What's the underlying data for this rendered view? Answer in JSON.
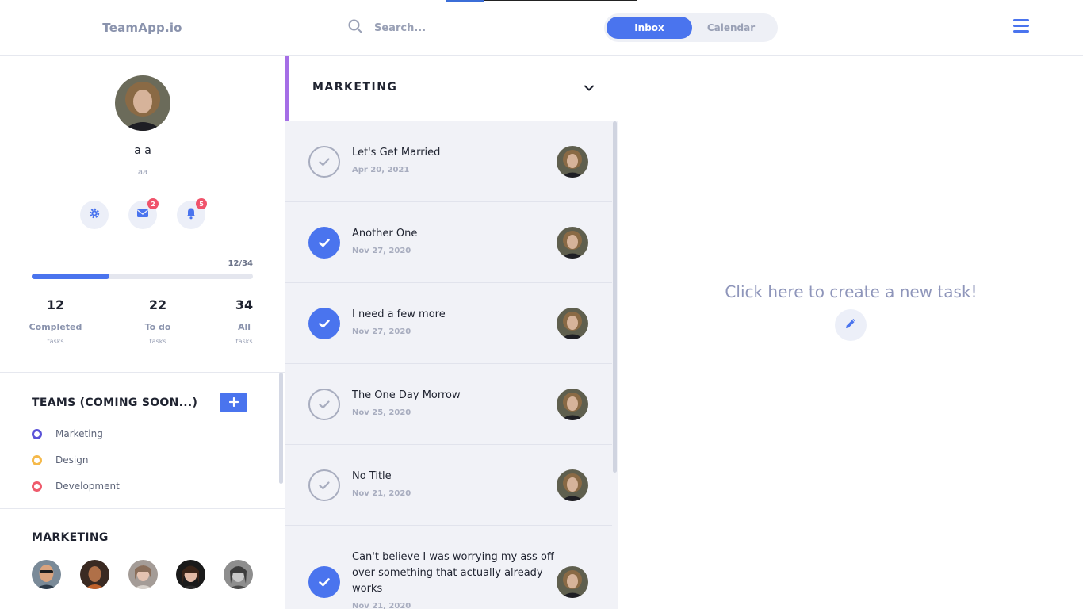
{
  "brand": {
    "name": "TeamApp.io"
  },
  "search": {
    "placeholder": "Search...",
    "icon": "search-icon"
  },
  "view_toggle": {
    "inbox_label": "Inbox",
    "calendar_label": "Calendar",
    "active": "Inbox"
  },
  "menu": {
    "icon": "hamburger-menu-icon"
  },
  "colors": {
    "accent": "#4a74ee",
    "badge": "#f0536b",
    "section_accent": "#a56ee6",
    "team_marketing": "#5b53d8",
    "team_design": "#f5b94a",
    "team_development": "#ef5b6c"
  },
  "profile": {
    "name": "a a",
    "handle": "aa",
    "buttons": [
      {
        "icon": "gear-icon",
        "badge": null
      },
      {
        "icon": "mail-icon",
        "badge": "2"
      },
      {
        "icon": "bell-icon",
        "badge": "5"
      }
    ]
  },
  "progress": {
    "count_text": "12/34",
    "completed": 12,
    "total": 34
  },
  "stats": [
    {
      "value": "12",
      "label": "Completed",
      "sub": "tasks"
    },
    {
      "value": "22",
      "label": "To do",
      "sub": "tasks"
    },
    {
      "value": "34",
      "label": "All",
      "sub": "tasks"
    }
  ],
  "teams": {
    "title": "TEAMS (COMING SOON...)",
    "add_icon": "plus-icon",
    "items": [
      {
        "label": "Marketing"
      },
      {
        "label": "Design"
      },
      {
        "label": "Development"
      }
    ]
  },
  "members_section": {
    "title": "MARKETING",
    "member_count": 5
  },
  "task_list": {
    "title": "MARKETING",
    "tasks": [
      {
        "title": "Let's Get Married",
        "date": "Apr 20, 2021",
        "done": false
      },
      {
        "title": "Another One",
        "date": "Nov 27, 2020",
        "done": true
      },
      {
        "title": "I need a few more",
        "date": "Nov 27, 2020",
        "done": true
      },
      {
        "title": "The One Day Morrow",
        "date": "Nov 25, 2020",
        "done": false
      },
      {
        "title": "No Title",
        "date": "Nov 21, 2020",
        "done": false
      },
      {
        "title": "Can't believe I was worrying my ass off over something that actually already works",
        "date": "Nov 21, 2020",
        "done": true
      }
    ]
  },
  "detail": {
    "create_text": "Click here to create a new task!",
    "create_icon": "pencil-icon"
  }
}
